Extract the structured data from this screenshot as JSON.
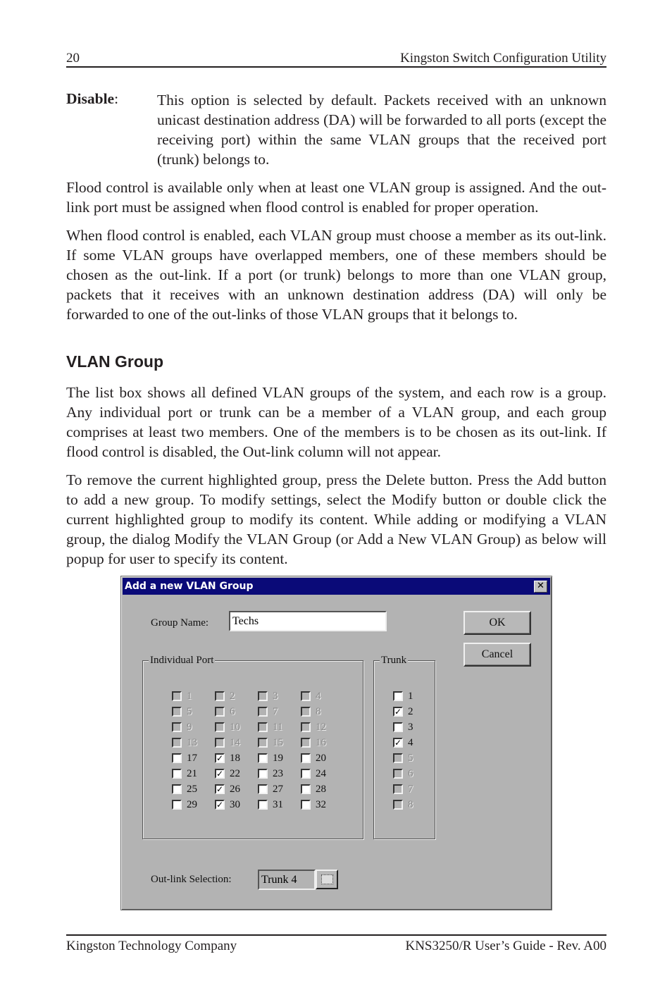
{
  "header": {
    "page_number": "20",
    "title": "Kingston Switch Configuration Utility"
  },
  "definition": {
    "term": "Disable",
    "colon": ":",
    "body": "This option is selected by default. Packets received with an unknown unicast destination address (DA) will be forwarded to all ports (except the receiving port) within the same VLAN groups that the received port (trunk) belongs to."
  },
  "paragraphs": {
    "flood_control": "Flood control is available only when at least one VLAN group is assigned. And the out-link port must be assigned when flood control is enabled for proper operation.",
    "when_enabled": "When flood control is enabled, each VLAN group must choose a member as its out-link. If some VLAN groups have overlapped members, one of these members should be chosen as the out-link. If a port (or trunk) belongs to more than one VLAN group, packets that it receives with an unknown destination address (DA) will only be forwarded to one of the out-links of those VLAN groups that it belongs to.",
    "list_box": "The list box shows all defined VLAN groups of the system, and each row is a group. Any individual port or trunk can be a member of a VLAN group, and each group comprises at least two members. One of the members is to be chosen as its out-link. If flood control is disabled, the Out-link column will not appear.",
    "remove": "To remove the current highlighted group, press the Delete button. Press the Add button to add a new group. To modify settings, select the Modify button or double click the current highlighted group to modify its content. While adding or modifying a VLAN group, the dialog Modify the VLAN Group (or Add a New VLAN Group) as below will popup for user to specify its content."
  },
  "section_title": "VLAN Group",
  "dialog": {
    "title": "Add a new VLAN Group",
    "close_glyph": "✕",
    "group_name_label": "Group Name:",
    "group_name_value": "Techs",
    "ok_label": "OK",
    "cancel_label": "Cancel",
    "individual_port_label": "Individual Port",
    "trunk_label": "Trunk",
    "outlink_label": "Out-link Selection:",
    "outlink_value": "Trunk 4",
    "check_glyph": "✓",
    "ports": [
      {
        "label": "1",
        "checked": false,
        "enabled": false
      },
      {
        "label": "2",
        "checked": false,
        "enabled": false
      },
      {
        "label": "3",
        "checked": false,
        "enabled": false
      },
      {
        "label": "4",
        "checked": false,
        "enabled": false
      },
      {
        "label": "5",
        "checked": false,
        "enabled": false
      },
      {
        "label": "6",
        "checked": false,
        "enabled": false
      },
      {
        "label": "7",
        "checked": false,
        "enabled": false
      },
      {
        "label": "8",
        "checked": false,
        "enabled": false
      },
      {
        "label": "9",
        "checked": false,
        "enabled": false
      },
      {
        "label": "10",
        "checked": false,
        "enabled": false
      },
      {
        "label": "11",
        "checked": false,
        "enabled": false
      },
      {
        "label": "12",
        "checked": false,
        "enabled": false
      },
      {
        "label": "13",
        "checked": false,
        "enabled": false
      },
      {
        "label": "14",
        "checked": false,
        "enabled": false
      },
      {
        "label": "15",
        "checked": false,
        "enabled": false
      },
      {
        "label": "16",
        "checked": false,
        "enabled": false
      },
      {
        "label": "17",
        "checked": false,
        "enabled": true
      },
      {
        "label": "18",
        "checked": true,
        "enabled": true
      },
      {
        "label": "19",
        "checked": false,
        "enabled": true
      },
      {
        "label": "20",
        "checked": false,
        "enabled": true
      },
      {
        "label": "21",
        "checked": false,
        "enabled": true
      },
      {
        "label": "22",
        "checked": true,
        "enabled": true
      },
      {
        "label": "23",
        "checked": false,
        "enabled": true
      },
      {
        "label": "24",
        "checked": false,
        "enabled": true
      },
      {
        "label": "25",
        "checked": false,
        "enabled": true
      },
      {
        "label": "26",
        "checked": true,
        "enabled": true
      },
      {
        "label": "27",
        "checked": false,
        "enabled": true
      },
      {
        "label": "28",
        "checked": false,
        "enabled": true
      },
      {
        "label": "29",
        "checked": false,
        "enabled": true
      },
      {
        "label": "30",
        "checked": true,
        "enabled": true
      },
      {
        "label": "31",
        "checked": false,
        "enabled": true
      },
      {
        "label": "32",
        "checked": false,
        "enabled": true
      }
    ],
    "trunks": [
      {
        "label": "1",
        "checked": false,
        "enabled": true
      },
      {
        "label": "2",
        "checked": true,
        "enabled": true
      },
      {
        "label": "3",
        "checked": false,
        "enabled": true
      },
      {
        "label": "4",
        "checked": true,
        "enabled": true
      },
      {
        "label": "5",
        "checked": false,
        "enabled": false
      },
      {
        "label": "6",
        "checked": false,
        "enabled": false
      },
      {
        "label": "7",
        "checked": false,
        "enabled": false
      },
      {
        "label": "8",
        "checked": false,
        "enabled": false
      }
    ]
  },
  "footer": {
    "left": "Kingston Technology Company",
    "right": "KNS3250/R User’s Guide - Rev. A00"
  }
}
